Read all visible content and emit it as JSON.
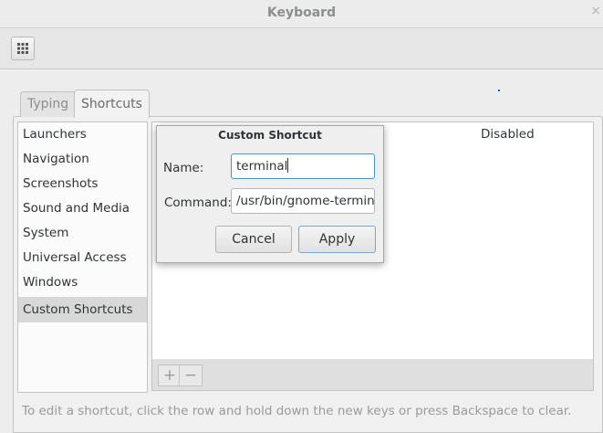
{
  "window": {
    "title": "Keyboard",
    "close_glyph": "×"
  },
  "toolbar": {
    "grid_icon": "app-grid-icon"
  },
  "tabs": [
    {
      "label": "Typing",
      "active": false
    },
    {
      "label": "Shortcuts",
      "active": true
    }
  ],
  "categories": [
    {
      "label": "Launchers"
    },
    {
      "label": "Navigation"
    },
    {
      "label": "Screenshots"
    },
    {
      "label": "Sound and Media"
    },
    {
      "label": "System"
    },
    {
      "label": "Universal Access"
    },
    {
      "label": "Windows"
    },
    {
      "label": "Custom Shortcuts",
      "selected": true
    }
  ],
  "shortcut_pane": {
    "row_status": "Disabled",
    "add_glyph": "+",
    "remove_glyph": "−"
  },
  "hint": "To edit a shortcut, click the row and hold down the new keys or press Backspace to clear.",
  "dialog": {
    "title": "Custom Shortcut",
    "name_label": "Name:",
    "name_value": "terminal",
    "command_label": "Command:",
    "command_value": "/usr/bin/gnome-terminal",
    "cancel_label": "Cancel",
    "apply_label": "Apply"
  },
  "colors": {
    "focus_border": "#4a90d9",
    "selection": "#d8d8d8",
    "window_bg": "#ededed"
  }
}
